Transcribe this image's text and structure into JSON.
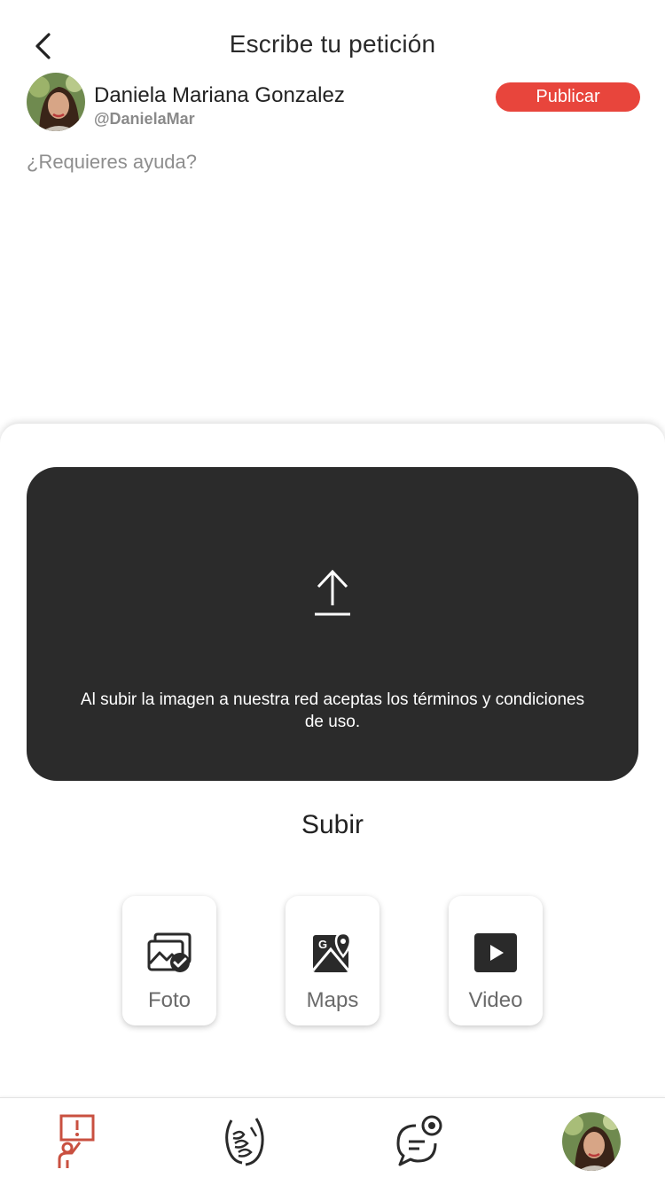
{
  "header": {
    "title": "Escribe tu petición"
  },
  "user": {
    "name": "Daniela Mariana Gonzalez",
    "handle": "@DanielaMar"
  },
  "actions": {
    "publish_label": "Publicar"
  },
  "request": {
    "placeholder": "¿Requieres ayuda?"
  },
  "upload": {
    "terms_text": "Al subir la imagen a nuestra red aceptas los términos y condiciones de uso.",
    "caption": "Subir"
  },
  "media": [
    {
      "label": "Foto",
      "icon": "photo-gallery-icon"
    },
    {
      "label": "Maps",
      "icon": "map-pin-icon"
    },
    {
      "label": "Video",
      "icon": "play-video-icon"
    }
  ],
  "tabbar": [
    {
      "icon": "help-request-icon"
    },
    {
      "icon": "handshake-icon"
    },
    {
      "icon": "chat-view-icon"
    },
    {
      "icon": "profile-avatar"
    }
  ],
  "colors": {
    "accent": "#e8453c",
    "upload_card": "#2b2b2b",
    "text": "#222222",
    "muted": "#8e8e8e"
  }
}
